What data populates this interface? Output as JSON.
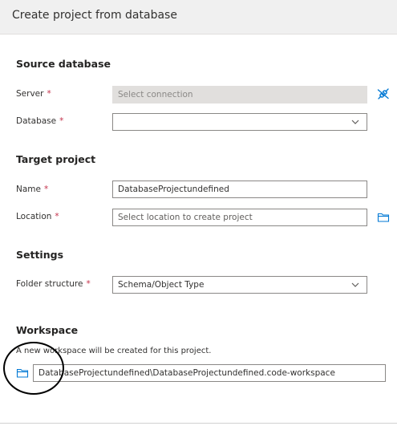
{
  "dialog": {
    "title": "Create project from database"
  },
  "source": {
    "title": "Source database",
    "server": {
      "label": "Server",
      "placeholder": "Select connection"
    },
    "database": {
      "label": "Database",
      "value": ""
    }
  },
  "target": {
    "title": "Target project",
    "name": {
      "label": "Name",
      "value": "DatabaseProjectundefined"
    },
    "location": {
      "label": "Location",
      "placeholder": "Select location to create project"
    }
  },
  "settings": {
    "title": "Settings",
    "folder_structure": {
      "label": "Folder structure",
      "value": "Schema/Object Type"
    }
  },
  "workspace": {
    "title": "Workspace",
    "description": "A new workspace will be created for this project.",
    "path": "DatabaseProjectundefined\\DatabaseProjectundefined.code-workspace"
  },
  "required_marker": "*",
  "icons": {
    "connect": "plug-connect-icon",
    "folder": "folder-icon",
    "chevron": "chevron-down-icon"
  },
  "colors": {
    "accent": "#0078d4",
    "required": "#c4314b",
    "header_bg": "#f0f0f0",
    "disabled_bg": "#e1dfdd"
  }
}
